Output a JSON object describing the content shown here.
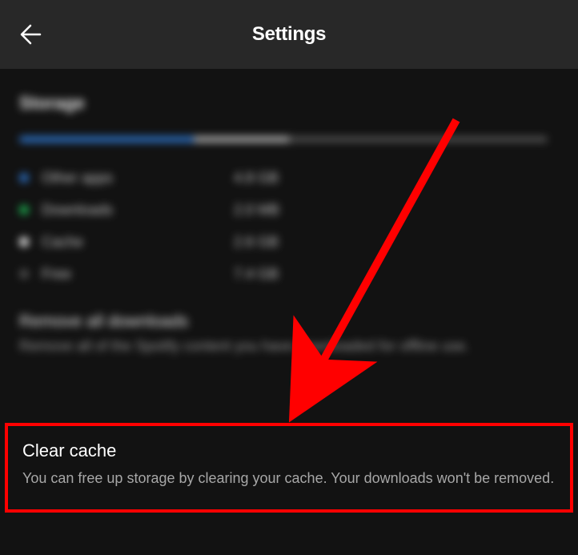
{
  "header": {
    "title": "Settings"
  },
  "storage": {
    "section_title": "Storage",
    "bar": {
      "blue_pct": 33,
      "light_pct": 18
    },
    "legend": [
      {
        "label": "Other apps",
        "value": "4.8 GB",
        "color": "#2e77d0"
      },
      {
        "label": "Downloads",
        "value": "2.0 MB",
        "color": "#1db954"
      },
      {
        "label": "Cache",
        "value": "2.6 GB",
        "color": "#ffffff"
      },
      {
        "label": "Free",
        "value": "7.4 GB",
        "color": "#535353"
      }
    ]
  },
  "remove_downloads": {
    "title": "Remove all downloads",
    "desc": "Remove all of the Spotify content you have downloaded for offline use."
  },
  "clear_cache": {
    "title": "Clear cache",
    "desc": "You can free up storage by clearing your cache. Your downloads won't be removed."
  }
}
